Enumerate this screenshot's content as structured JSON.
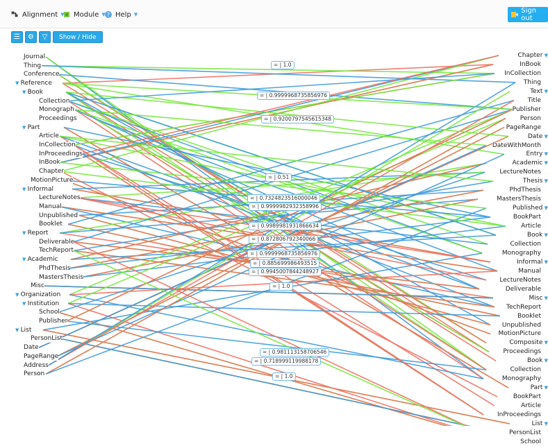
{
  "header": {
    "menus": [
      {
        "label": "Alignment",
        "icon": "alignment-icon"
      },
      {
        "label": "Module",
        "icon": "module-icon"
      },
      {
        "label": "Help",
        "icon": "help-icon"
      }
    ],
    "signout_label": "Sign out"
  },
  "toolbar": {
    "show_hide_label": "Show / Hide"
  },
  "colors": {
    "accent": "#2aa8e8",
    "line_green": "#76e83c",
    "line_red": "#ef7060",
    "line_blue": "#3e9bdc"
  },
  "left_tree": [
    {
      "label": "Journal",
      "tri": false
    },
    {
      "label": "Thing",
      "tri": false
    },
    {
      "label": "Conference",
      "tri": false
    },
    {
      "label": "Reference",
      "tri": true
    },
    {
      "label": "Book",
      "tri": true
    },
    {
      "label": "Collection",
      "tri": false
    },
    {
      "label": "Monograph",
      "tri": false
    },
    {
      "label": "Proceedings",
      "tri": false
    },
    {
      "label": "Part",
      "tri": true
    },
    {
      "label": "Article",
      "tri": false
    },
    {
      "label": "InCollection",
      "tri": false
    },
    {
      "label": "InProceedings",
      "tri": false
    },
    {
      "label": "InBook",
      "tri": false
    },
    {
      "label": "Chapter",
      "tri": false
    },
    {
      "label": "MotionPicture",
      "tri": false
    },
    {
      "label": "Informal",
      "tri": true
    },
    {
      "label": "LectureNotes",
      "tri": false
    },
    {
      "label": "Manual",
      "tri": false
    },
    {
      "label": "Unpublished",
      "tri": false
    },
    {
      "label": "Booklet",
      "tri": false
    },
    {
      "label": "Report",
      "tri": true
    },
    {
      "label": "Deliverable",
      "tri": false
    },
    {
      "label": "TechReport",
      "tri": false
    },
    {
      "label": "Academic",
      "tri": true
    },
    {
      "label": "PhdThesis",
      "tri": false
    },
    {
      "label": "MastersThesis",
      "tri": false
    },
    {
      "label": "Misc",
      "tri": false
    },
    {
      "label": "Organization",
      "tri": true
    },
    {
      "label": "Institution",
      "tri": true
    },
    {
      "label": "School",
      "tri": false
    },
    {
      "label": "Publisher",
      "tri": false
    },
    {
      "label": "List",
      "tri": true
    },
    {
      "label": "PersonList",
      "tri": false
    },
    {
      "label": "Date",
      "tri": false
    },
    {
      "label": "PageRange",
      "tri": false
    },
    {
      "label": "Address",
      "tri": false
    },
    {
      "label": "Person",
      "tri": false
    }
  ],
  "right_tree": [
    {
      "label": "Chapter",
      "tri": true
    },
    {
      "label": "InBook",
      "tri": false
    },
    {
      "label": "InCollection",
      "tri": false
    },
    {
      "label": "Thing",
      "tri": false
    },
    {
      "label": "Text",
      "tri": true
    },
    {
      "label": "Title",
      "tri": false
    },
    {
      "label": "Publisher",
      "tri": false
    },
    {
      "label": "Person",
      "tri": false
    },
    {
      "label": "PageRange",
      "tri": false
    },
    {
      "label": "Date",
      "tri": true
    },
    {
      "label": "DateWithMonth",
      "tri": false
    },
    {
      "label": "Entry",
      "tri": true
    },
    {
      "label": "Academic",
      "tri": true
    },
    {
      "label": "LectureNotes",
      "tri": false
    },
    {
      "label": "Thesis",
      "tri": true
    },
    {
      "label": "PhdThesis",
      "tri": false
    },
    {
      "label": "MastersThesis",
      "tri": false
    },
    {
      "label": "Published",
      "tri": true
    },
    {
      "label": "BookPart",
      "tri": false
    },
    {
      "label": "Article",
      "tri": false
    },
    {
      "label": "Book",
      "tri": true
    },
    {
      "label": "Collection",
      "tri": false
    },
    {
      "label": "Monography",
      "tri": false
    },
    {
      "label": "Informal",
      "tri": true
    },
    {
      "label": "Manual",
      "tri": false
    },
    {
      "label": "LectureNotes",
      "tri": false
    },
    {
      "label": "Deliverable",
      "tri": false
    },
    {
      "label": "Misc",
      "tri": true
    },
    {
      "label": "TechReport",
      "tri": false
    },
    {
      "label": "Booklet",
      "tri": false
    },
    {
      "label": "Unpublished",
      "tri": false
    },
    {
      "label": "MotionPicture",
      "tri": false
    },
    {
      "label": "Composite",
      "tri": true
    },
    {
      "label": "Proceedings",
      "tri": false
    },
    {
      "label": "Book",
      "tri": true
    },
    {
      "label": "Collection",
      "tri": false
    },
    {
      "label": "Monography",
      "tri": false
    },
    {
      "label": "Part",
      "tri": true
    },
    {
      "label": "BookPart",
      "tri": false
    },
    {
      "label": "Article",
      "tri": false
    },
    {
      "label": "InProceedings",
      "tri": false
    },
    {
      "label": "List",
      "tri": true
    },
    {
      "label": "PersonList",
      "tri": false
    },
    {
      "label": "School",
      "tri": false
    }
  ],
  "scores": [
    "= | 1.0",
    "= | 0.9999968735856976",
    "= | 0.9200797545615348",
    "= | 0.51",
    "= | 0.7324823516000046",
    "= | 0.9999982932358996",
    "= | 0.9989981931866634",
    "= | 0.872806792340066",
    "= | 0.9999968735856976",
    "= | 0.885699986493515",
    "= | 0.9945007844248927",
    "= | 1.0",
    "= | 0.981113158706546",
    "= | 0.718999119988178",
    "= | 1.0"
  ]
}
